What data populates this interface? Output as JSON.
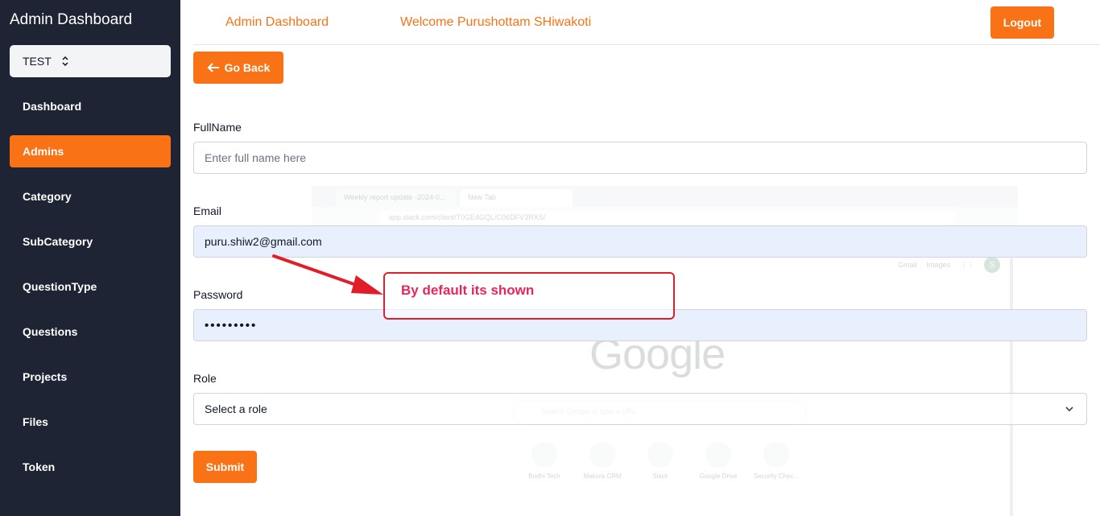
{
  "sidebar": {
    "title": "Admin Dashboard",
    "project_select": {
      "value": "TEST"
    },
    "items": [
      {
        "label": "Dashboard",
        "active": false
      },
      {
        "label": "Admins",
        "active": true
      },
      {
        "label": "Category",
        "active": false
      },
      {
        "label": "SubCategory",
        "active": false
      },
      {
        "label": "QuestionType",
        "active": false
      },
      {
        "label": "Questions",
        "active": false
      },
      {
        "label": "Projects",
        "active": false
      },
      {
        "label": "Files",
        "active": false
      },
      {
        "label": "Token",
        "active": false
      }
    ]
  },
  "header": {
    "title_link": "Admin Dashboard",
    "welcome": "Welcome Purushottam SHiwakoti",
    "logout_label": "Logout"
  },
  "main": {
    "go_back_label": "Go Back",
    "fields": {
      "fullname": {
        "label": "FullName",
        "placeholder": "Enter full name here",
        "value": ""
      },
      "email": {
        "label": "Email",
        "value": "puru.shiw2@gmail.com"
      },
      "password": {
        "label": "Password",
        "value": "•••••••••"
      },
      "role": {
        "label": "Role",
        "value": "Select a role"
      }
    },
    "submit_label": "Submit"
  },
  "annotation": {
    "text": "By default its shown",
    "color": "#e8265e"
  },
  "background_browser": {
    "tabs": [
      "Weekly report update -2024-0...",
      "New Tab"
    ],
    "url": "app.slack.com/client/T0GE4GQL/C06DFV3RXS/",
    "bookmarks": "All Bookmarks",
    "top_links": [
      "Gmail",
      "Images"
    ],
    "avatar": "S",
    "logo": "Google",
    "search_placeholder": "Search Google or type a URL",
    "shortcuts": [
      "Bodhi Tech",
      "Makura CRM",
      "Slack",
      "Google Drive",
      "Security Chec..."
    ]
  },
  "colors": {
    "accent": "#f97316",
    "sidebar_bg": "#1e2433",
    "autofill_bg": "#e8f0fe"
  }
}
